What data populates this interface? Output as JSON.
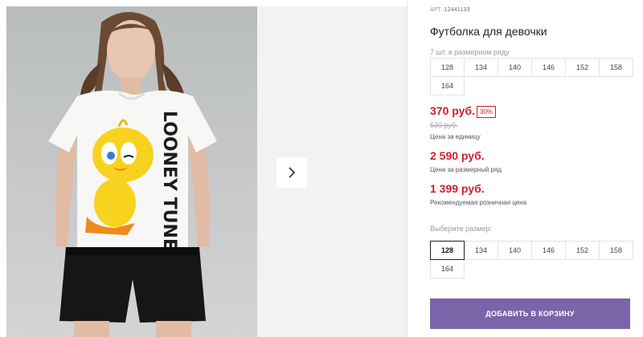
{
  "product": {
    "article_label": "АРТ.",
    "article_number": "12441133",
    "title": "Футболка для девочки",
    "pack_note": "7 шт. в размерном ряду",
    "pack_sizes": [
      "128",
      "134",
      "140",
      "146",
      "152",
      "158",
      "164"
    ]
  },
  "pricing": {
    "unit_price": "370 руб.",
    "discount": "30%",
    "old_price": "530 руб.",
    "unit_label": "Цена за единицу",
    "pack_price": "2 590 руб.",
    "pack_label": "Цена за размерный ряд",
    "retail_price": "1 399 руб.",
    "retail_label": "Рекомендуемая розничная цена"
  },
  "size_picker": {
    "label": "Выберите размер:",
    "sizes": [
      "128",
      "134",
      "140",
      "146",
      "152",
      "158",
      "164"
    ],
    "selected": "128"
  },
  "cart_button": "ДОБАВИТЬ В КОРЗИНУ",
  "gallery": {
    "next_icon": "chevron-right-icon",
    "shirt_print_text": "LOONEY TUNES"
  },
  "colors": {
    "accent_price": "#d21d2c",
    "cart_button": "#7b65a8"
  }
}
